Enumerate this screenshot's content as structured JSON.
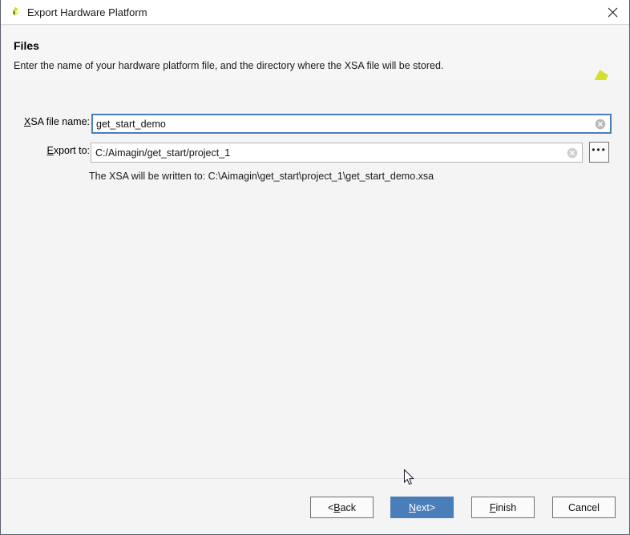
{
  "window": {
    "title": "Export Hardware Platform",
    "app_icon": "vivado-pinwheel-icon",
    "close_label": "✕"
  },
  "header": {
    "title": "Files",
    "subtitle": "Enter the name of your hardware platform file, and the directory where the XSA file will be stored.",
    "brand_icon": "xilinx-pinwheel-logo"
  },
  "form": {
    "fields": [
      {
        "label_mnemonic": "X",
        "label_rest": "SA file name:",
        "value": "get_start_demo",
        "clear_icon": "clear-circle-icon",
        "focused": true
      },
      {
        "label_mnemonic": "E",
        "label_rest": "xport to:",
        "value": "C:/Aimagin/get_start/project_1",
        "clear_icon": "clear-circle-icon",
        "focused": false,
        "browse_label": "•••"
      }
    ],
    "hint": "The XSA will be written to: C:\\Aimagin\\get_start\\project_1\\get_start_demo.xsa"
  },
  "footer": {
    "buttons": [
      {
        "prefix": "< ",
        "mnemonic": "B",
        "rest": "ack",
        "suffix": "",
        "primary": false
      },
      {
        "prefix": "",
        "mnemonic": "N",
        "rest": "ext",
        "suffix": " >",
        "primary": true
      },
      {
        "prefix": "",
        "mnemonic": "F",
        "rest": "inish",
        "suffix": "",
        "primary": false
      },
      {
        "prefix": "",
        "mnemonic": "",
        "rest": "Cancel",
        "suffix": "",
        "primary": false
      }
    ]
  },
  "colors": {
    "accent": "#4a7ebb",
    "body_bg": "#f4f4f4",
    "titlebar_bg": "#ffffff",
    "logo_bright": "#d6e02c",
    "logo_dark": "#6e7106",
    "logo_light": "#e6ee7a"
  }
}
